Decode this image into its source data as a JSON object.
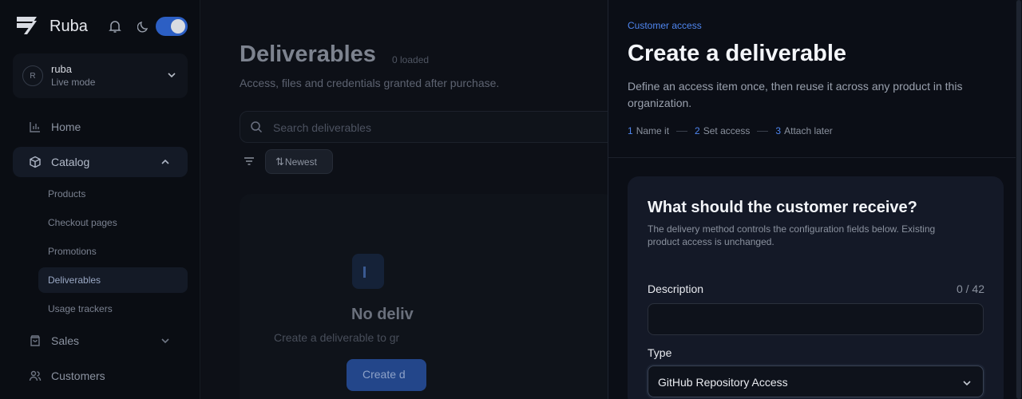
{
  "app": {
    "name": "Ruba"
  },
  "account": {
    "avatar_initial": "R",
    "name": "ruba",
    "mode": "Live mode"
  },
  "sidebar": {
    "items": [
      {
        "label": "Home",
        "icon": "bar-chart-icon"
      },
      {
        "label": "Catalog",
        "icon": "box-icon"
      },
      {
        "label": "Sales",
        "icon": "shopping-bag-icon"
      },
      {
        "label": "Customers",
        "icon": "users-icon"
      }
    ],
    "catalog_children": [
      {
        "label": "Products"
      },
      {
        "label": "Checkout pages"
      },
      {
        "label": "Promotions"
      },
      {
        "label": "Deliverables"
      },
      {
        "label": "Usage trackers"
      }
    ]
  },
  "main": {
    "title": "Deliverables",
    "loaded": "0 loaded",
    "subtitle": "Access, files and credentials granted after purchase.",
    "search_placeholder": "Search deliverables",
    "sort_label": "Newest",
    "empty_title": "No deliv",
    "empty_subtitle": "Create a deliverable to gr",
    "create_button": "Create d"
  },
  "drawer": {
    "eyebrow": "Customer access",
    "title": "Create a deliverable",
    "description": "Define an access item once, then reuse it across any product in this organization.",
    "steps": [
      {
        "num": "1",
        "label": "Name it"
      },
      {
        "num": "2",
        "label": "Set access"
      },
      {
        "num": "3",
        "label": "Attach later"
      }
    ],
    "form": {
      "heading": "What should the customer receive?",
      "help": "The delivery method controls the configuration fields below. Existing product access is unchanged.",
      "description_label": "Description",
      "description_count": "0 / 42",
      "description_value": "",
      "type_label": "Type",
      "type_value": "GitHub Repository Access"
    }
  },
  "colors": {
    "accent": "#4f86f0",
    "toggle": "#2c5fc4"
  }
}
